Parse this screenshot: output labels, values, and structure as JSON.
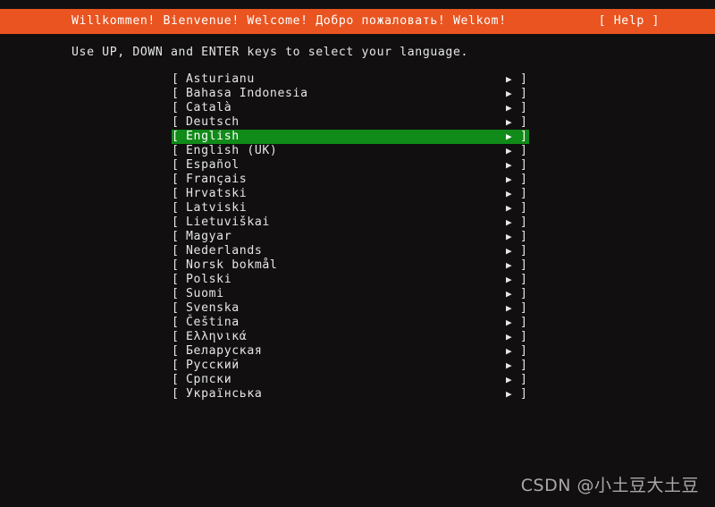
{
  "screen": {
    "background_color": "#110f0f",
    "foreground_color": "#e6e6e6"
  },
  "header": {
    "background_color": "#e95420",
    "greeting": "Willkommen! Bienvenue! Welcome! Добро пожаловать! Welkom!",
    "help_label": "[ Help ]"
  },
  "instruction": {
    "text": "Use UP, DOWN and ENTER keys to select your language."
  },
  "language_menu": {
    "bracket_left": "[",
    "bracket_right": "]",
    "arrow_icon": "▶",
    "selected_index": 4,
    "highlight_color": "#108a18",
    "items": [
      {
        "label": "Asturianu"
      },
      {
        "label": "Bahasa Indonesia"
      },
      {
        "label": "Català"
      },
      {
        "label": "Deutsch"
      },
      {
        "label": "English"
      },
      {
        "label": "English (UK)"
      },
      {
        "label": "Español"
      },
      {
        "label": "Français"
      },
      {
        "label": "Hrvatski"
      },
      {
        "label": "Latviski"
      },
      {
        "label": "Lietuviškai"
      },
      {
        "label": "Magyar"
      },
      {
        "label": "Nederlands"
      },
      {
        "label": "Norsk bokmål"
      },
      {
        "label": "Polski"
      },
      {
        "label": "Suomi"
      },
      {
        "label": "Svenska"
      },
      {
        "label": "Čeština"
      },
      {
        "label": "Ελληνικά"
      },
      {
        "label": "Беларуская"
      },
      {
        "label": "Русский"
      },
      {
        "label": "Српски"
      },
      {
        "label": "Українська"
      }
    ]
  },
  "watermark": {
    "text": "CSDN @小土豆大土豆"
  }
}
